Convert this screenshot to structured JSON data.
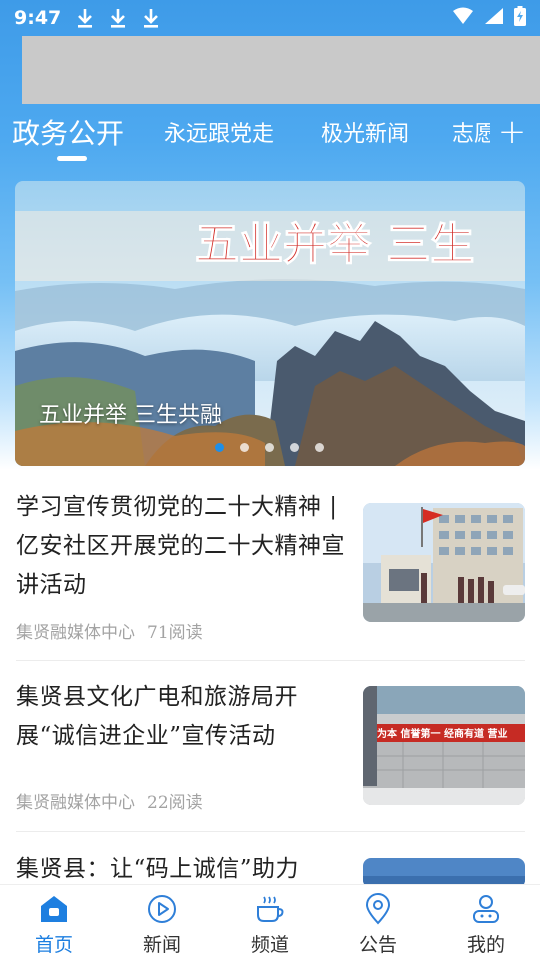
{
  "status_bar": {
    "time": "9:47",
    "download_icons": [
      "download-icon",
      "download-icon",
      "download-icon"
    ],
    "wifi_icon": "wifi-icon",
    "signal_icon": "signal-icon",
    "battery_icon": "battery-charging-icon"
  },
  "search": {
    "placeholder": ""
  },
  "tabs": [
    {
      "label": "政务公开",
      "active": true
    },
    {
      "label": "永远跟党走",
      "active": false
    },
    {
      "label": "极光新闻",
      "active": false
    },
    {
      "label": "志愿",
      "active": false
    }
  ],
  "add_tab_label": "+",
  "banner": {
    "image_text": "五业并举 三生",
    "caption": "五业并举  三生共融",
    "dots_total": 5,
    "dots_active_index": 0
  },
  "news": [
    {
      "title": "学习宣传贯彻党的二十大精神 | 亿安社区开展党的二十大精神宣讲活动",
      "source": "集贤融媒体中心",
      "reads": "71阅读"
    },
    {
      "title": "集贤县文化广电和旅游局开展“诚信进企业”宣传活动",
      "source": "集贤融媒体中心",
      "reads": "22阅读",
      "thumb_banner": "信为本 信誉第一 经商有道 营业"
    },
    {
      "title": "集贤县：让“码上诚信”助力",
      "source": "",
      "reads": ""
    }
  ],
  "bottom_nav": [
    {
      "label": "首页",
      "icon": "home-icon",
      "active": true
    },
    {
      "label": "新闻",
      "icon": "play-circle-icon",
      "active": false
    },
    {
      "label": "频道",
      "icon": "coffee-cup-icon",
      "active": false
    },
    {
      "label": "公告",
      "icon": "location-pin-icon",
      "active": false
    },
    {
      "label": "我的",
      "icon": "user-icon",
      "active": false
    }
  ],
  "colors": {
    "accent": "#1e7fe0",
    "header_blue": "#4ea9f0",
    "text_dark": "#222222",
    "text_meta": "#a3a3a3"
  }
}
